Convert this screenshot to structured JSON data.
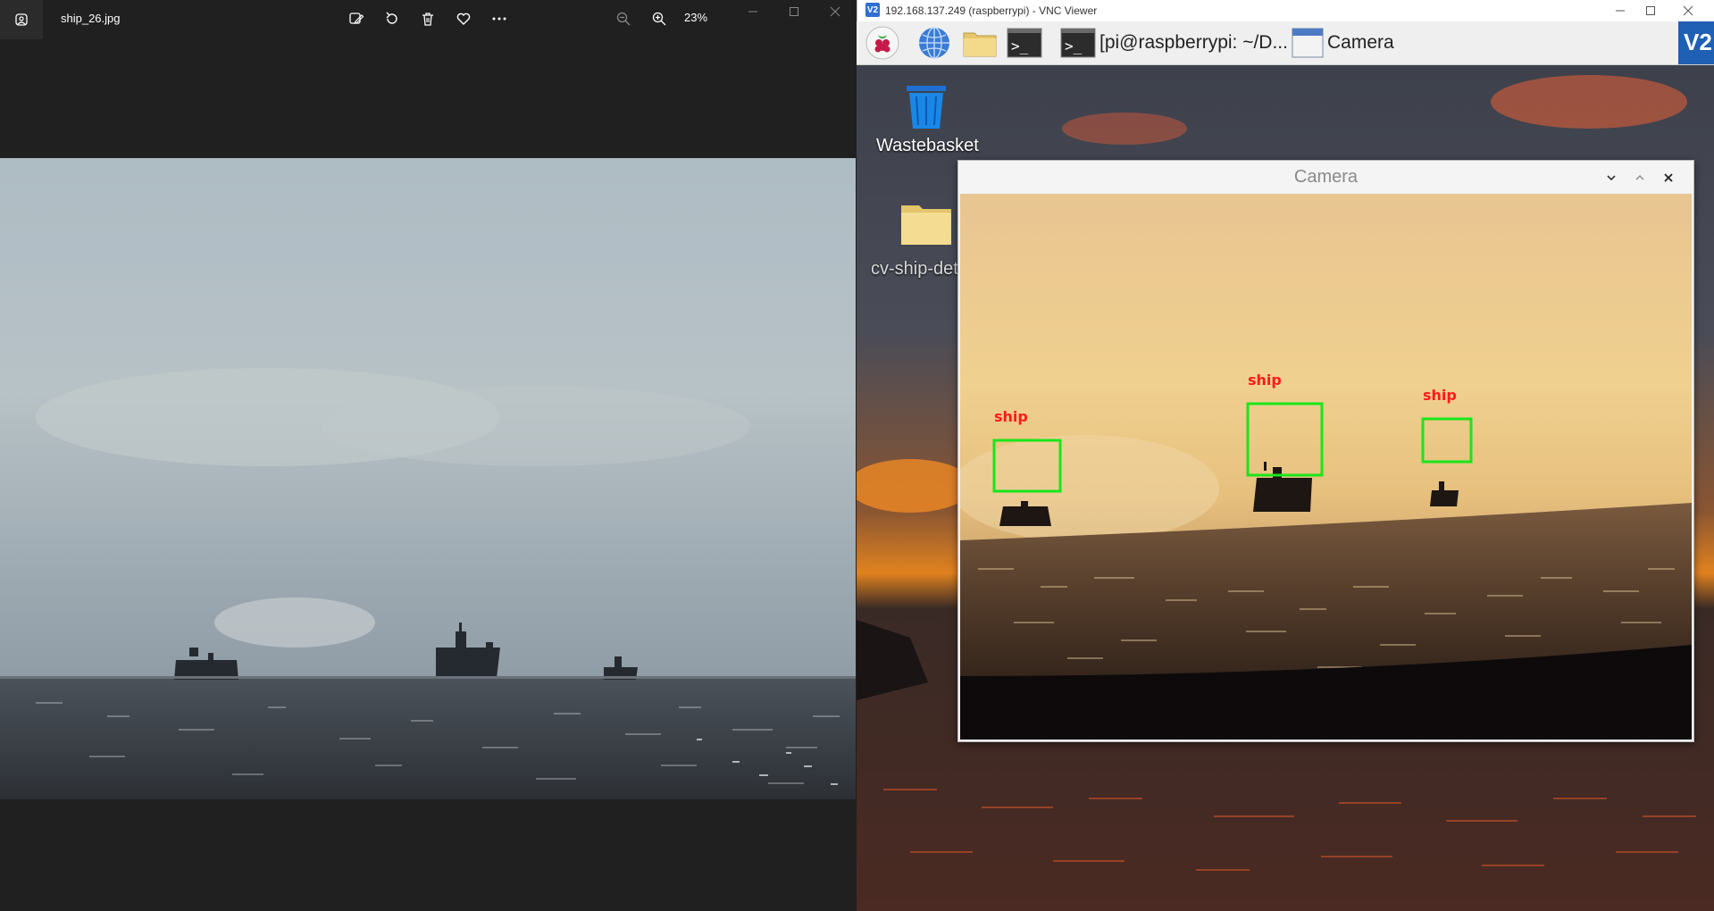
{
  "photos_app": {
    "filename": "ship_26.jpg",
    "zoom_level": "23%",
    "toolbar": {
      "edit": "edit-image-icon",
      "rotate": "rotate-icon",
      "delete": "delete-icon",
      "favorite": "heart-icon",
      "more": "more-icon",
      "zoom_out": "zoom-out-icon",
      "zoom_in": "zoom-in-icon"
    }
  },
  "vnc": {
    "title": "192.168.137.249 (raspberrypi) - VNC Viewer",
    "taskbar": {
      "terminal_label": "[pi@raspberrypi: ~/D...",
      "camera_label": "Camera"
    },
    "desktop_icons": {
      "wastebasket": "Wastebasket",
      "folder": "cv-ship-det"
    },
    "camera_window": {
      "title": "Camera",
      "detections": [
        {
          "label": "ship"
        },
        {
          "label": "ship"
        },
        {
          "label": "ship"
        }
      ]
    }
  },
  "colors": {
    "detection_box": "#19e619",
    "detection_label": "#ff1a1a",
    "photos_bg": "#202020"
  }
}
